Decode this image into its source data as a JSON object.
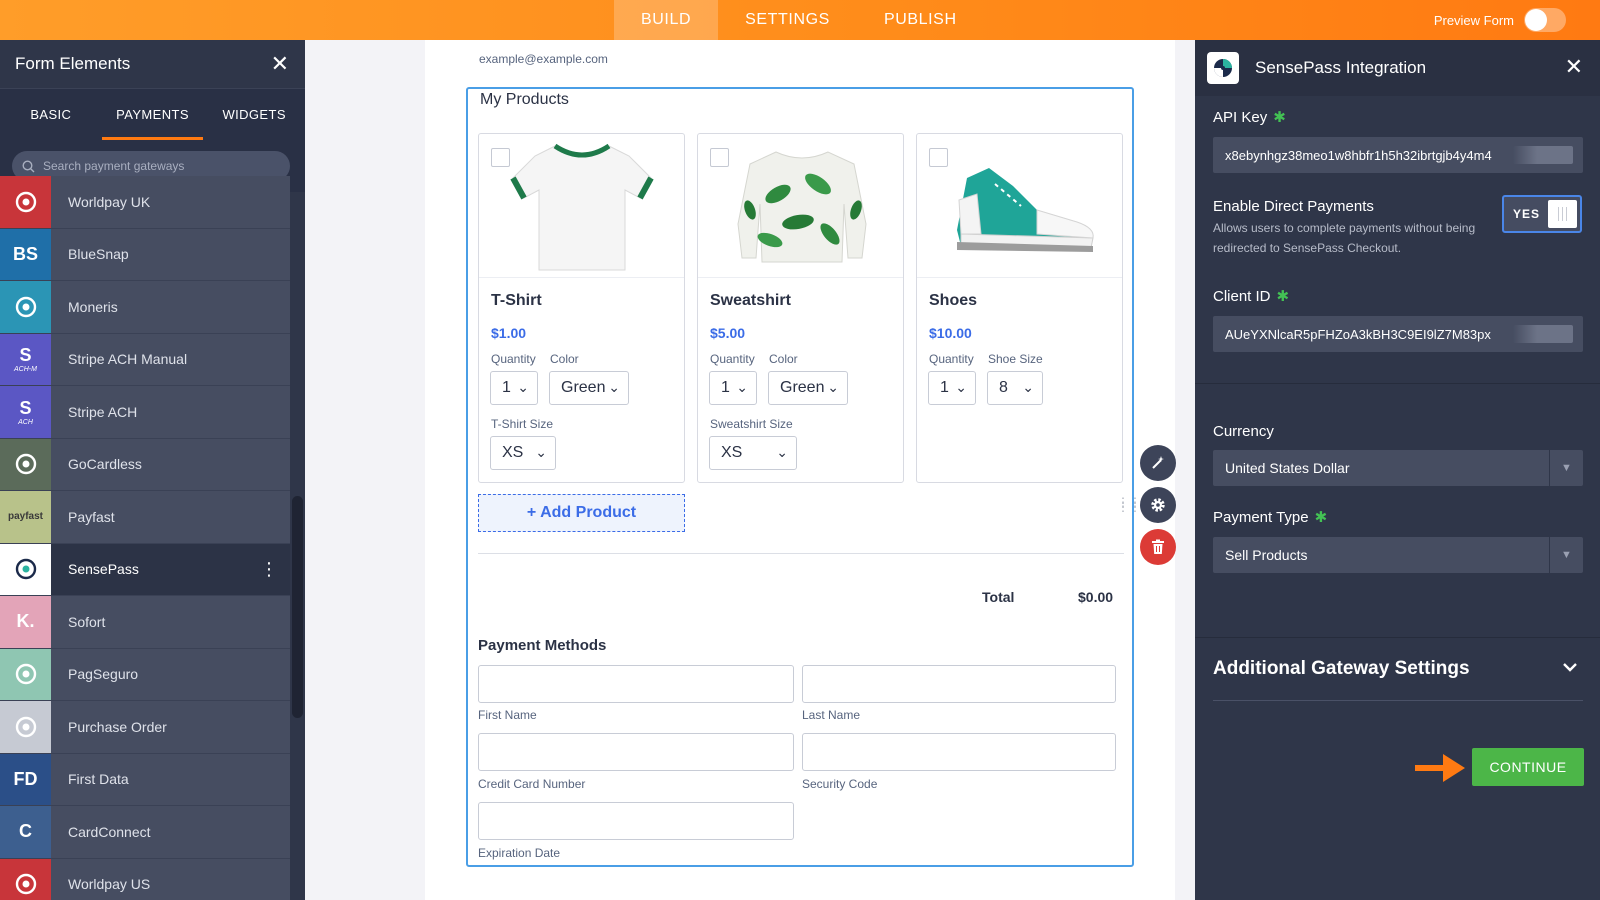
{
  "topbar": {
    "tabs": [
      {
        "label": "BUILD",
        "active": true
      },
      {
        "label": "SETTINGS",
        "active": false
      },
      {
        "label": "PUBLISH",
        "active": false
      }
    ],
    "preview_label": "Preview Form",
    "accent": "#ff8c1a"
  },
  "left_panel": {
    "title": "Form Elements",
    "tabs": [
      {
        "label": "BASIC",
        "active": false
      },
      {
        "label": "PAYMENTS",
        "active": true
      },
      {
        "label": "WIDGETS",
        "active": false
      }
    ],
    "search_placeholder": "Search payment gateways",
    "gateways": [
      {
        "label": "Worldpay UK",
        "icon": "worldpay-icon",
        "icon_bg": "#c8353a",
        "icon_text": ""
      },
      {
        "label": "BlueSnap",
        "icon": "bluesnap-icon",
        "icon_bg": "#1f6fa8",
        "icon_text": "BS"
      },
      {
        "label": "Moneris",
        "icon": "moneris-icon",
        "icon_bg": "#2b95b5",
        "icon_text": ""
      },
      {
        "label": "Stripe ACH Manual",
        "icon": "stripe-ach-manual-icon",
        "icon_bg": "#5b57c4",
        "icon_text": "S",
        "icon_sub": "ACH-M"
      },
      {
        "label": "Stripe ACH",
        "icon": "stripe-ach-icon",
        "icon_bg": "#5b57c4",
        "icon_text": "S",
        "icon_sub": "ACH"
      },
      {
        "label": "GoCardless",
        "icon": "gocardless-icon",
        "icon_bg": "#5b6b5a",
        "icon_text": ""
      },
      {
        "label": "Payfast",
        "icon": "payfast-icon",
        "icon_bg": "#b8c28a",
        "icon_text": "payfast"
      },
      {
        "label": "SensePass",
        "icon": "sensepass-icon",
        "icon_bg": "#ffffff",
        "icon_text": "",
        "active": true
      },
      {
        "label": "Sofort",
        "icon": "sofort-icon",
        "icon_bg": "#e3a4b8",
        "icon_text": "K."
      },
      {
        "label": "PagSeguro",
        "icon": "pagseguro-icon",
        "icon_bg": "#8fc6b2",
        "icon_text": ""
      },
      {
        "label": "Purchase Order",
        "icon": "cart-icon",
        "icon_bg": "#c6cad3",
        "icon_text": ""
      },
      {
        "label": "First Data",
        "icon": "first-data-icon",
        "icon_bg": "#2b4f88",
        "icon_text": "FD"
      },
      {
        "label": "CardConnect",
        "icon": "cardconnect-icon",
        "icon_bg": "#3d5f8f",
        "icon_text": "C"
      },
      {
        "label": "Worldpay US",
        "icon": "worldpay-icon",
        "icon_bg": "#c8353a",
        "icon_text": ""
      }
    ]
  },
  "form": {
    "email_sublabel": "example@example.com",
    "products_title": "My Products",
    "products": [
      {
        "name": "T-Shirt",
        "price": "$1.00",
        "opt1_label": "Quantity",
        "opt1_value": "1",
        "opt2_label": "Color",
        "opt2_value": "Green",
        "opt3_label": "T-Shirt Size",
        "opt3_value": "XS"
      },
      {
        "name": "Sweatshirt",
        "price": "$5.00",
        "opt1_label": "Quantity",
        "opt1_value": "1",
        "opt2_label": "Color",
        "opt2_value": "Green",
        "opt3_label": "Sweatshirt Size",
        "opt3_value": "XS"
      },
      {
        "name": "Shoes",
        "price": "$10.00",
        "opt1_label": "Quantity",
        "opt1_value": "1",
        "opt2_label": "Shoe Size",
        "opt2_value": "8"
      }
    ],
    "add_product_label": "+ Add Product",
    "total_label": "Total",
    "total_value": "$0.00",
    "payment_methods_title": "Payment Methods",
    "fields": {
      "first_name": "First Name",
      "last_name": "Last Name",
      "card_number": "Credit Card Number",
      "security_code": "Security Code",
      "expiration": "Expiration Date"
    }
  },
  "right_panel": {
    "title": "SensePass Integration",
    "api_key_label": "API Key",
    "api_key_value": "x8ebynhgz38meo1w8hbfr1h5h32ibrtgjb4y4m4",
    "direct_label": "Enable Direct Payments",
    "direct_desc": "Allows users to complete payments without being redirected to SensePass Checkout.",
    "direct_toggle": "YES",
    "client_id_label": "Client ID",
    "client_id_value": "AUeYXNlcaR5pFHZoA3kBH3C9EI9lZ7M83px",
    "currency_label": "Currency",
    "currency_value": "United States Dollar",
    "payment_type_label": "Payment Type",
    "payment_type_value": "Sell Products",
    "additional_settings": "Additional Gateway Settings",
    "continue_label": "CONTINUE",
    "continue_color": "#4cb648"
  }
}
